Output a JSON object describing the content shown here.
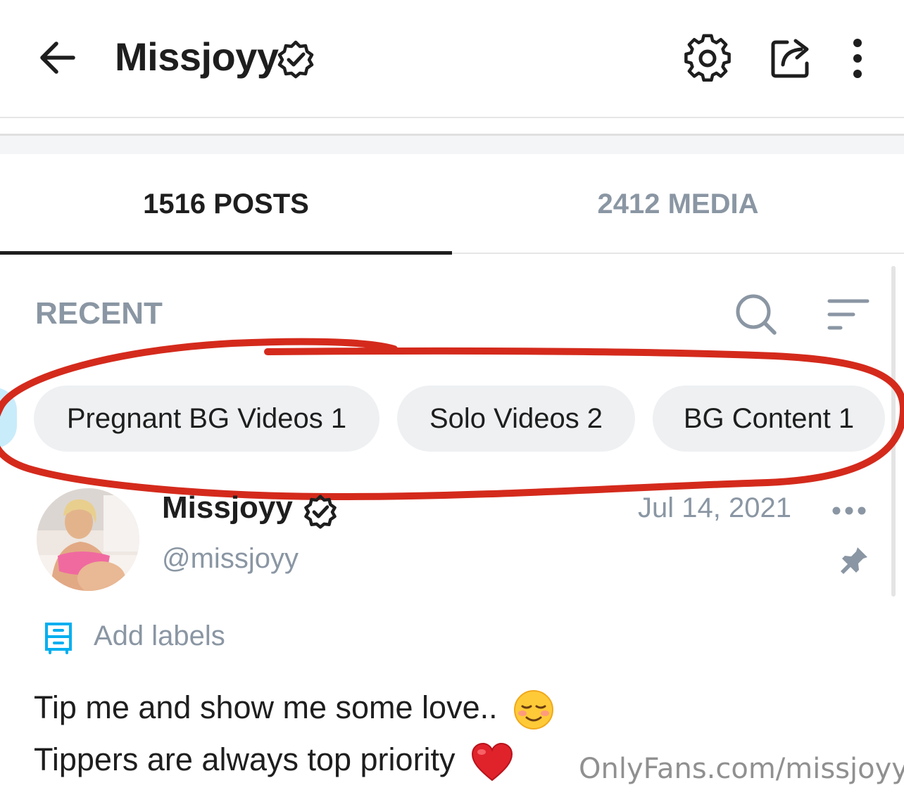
{
  "header": {
    "title": "Missjoyy",
    "icons": [
      "back-arrow-icon",
      "verified-badge-icon",
      "gear-icon",
      "share-icon",
      "more-vertical-icon"
    ]
  },
  "tabs": [
    {
      "label": "1516 POSTS",
      "active": true
    },
    {
      "label": "2412 MEDIA",
      "active": false
    }
  ],
  "feed": {
    "section_label": "RECENT",
    "chips": [
      {
        "label": "Pregnant BG Videos 1"
      },
      {
        "label": "Solo Videos 2"
      },
      {
        "label": "BG Content 1"
      }
    ]
  },
  "post": {
    "author_name": "Missjoyy",
    "author_handle": "@missjoyy",
    "date": "Jul 14, 2021",
    "add_labels": "Add labels",
    "text_line1": "Tip me and show me some love..",
    "text_line2": "Tippers are always top priority"
  },
  "watermark": "OnlyFans.com/missjoyy",
  "colors": {
    "text_primary": "#1e1e1e",
    "text_secondary": "#8a96a3",
    "accent_blue": "#00aff0",
    "chip_bg": "#eef0f2",
    "annotation_red": "#d42a1c"
  }
}
